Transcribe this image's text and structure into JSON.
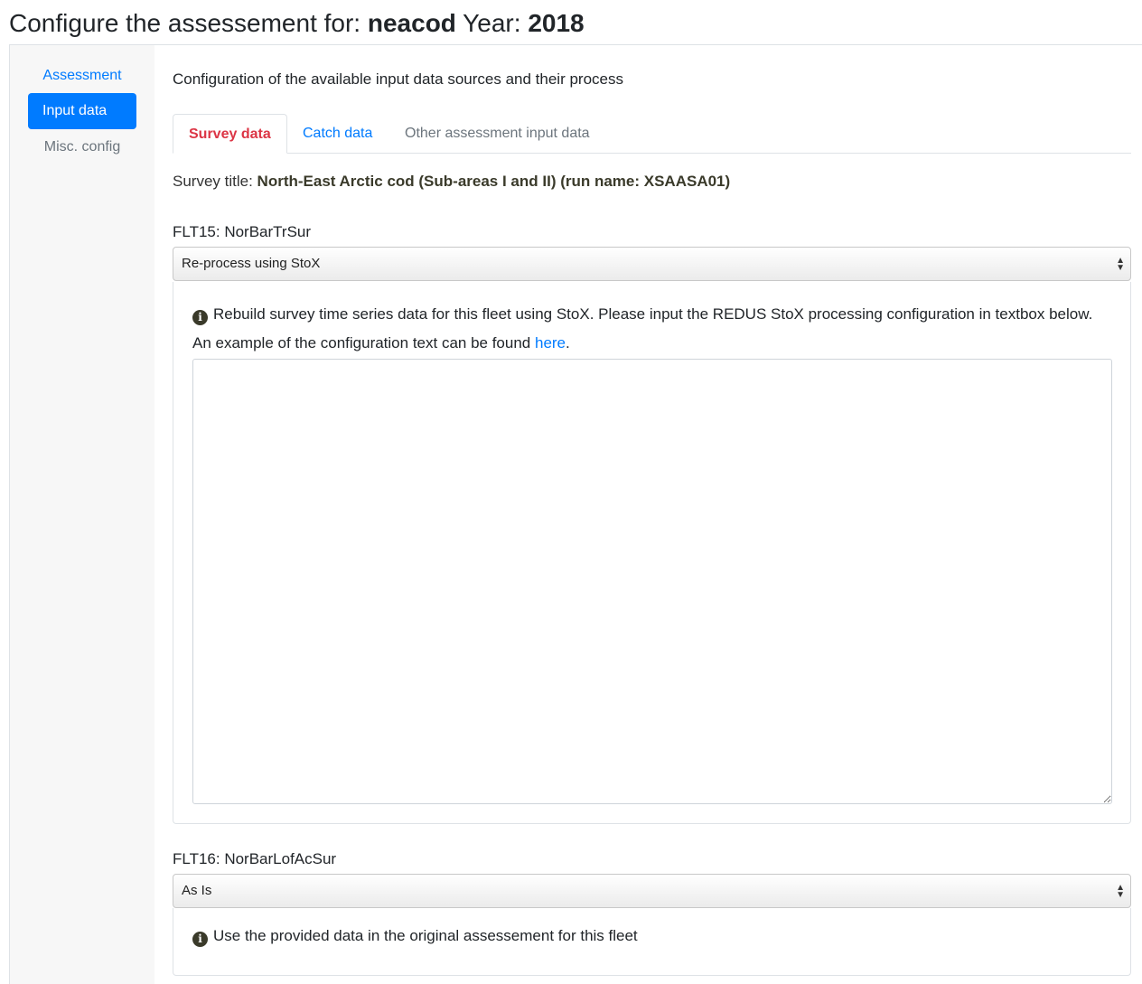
{
  "header": {
    "prefix": "Configure the assessement for: ",
    "stock": "neacod",
    "year_label": " Year: ",
    "year": "2018"
  },
  "sidebar": {
    "items": [
      {
        "label": "Assessment"
      },
      {
        "label": "Input data"
      },
      {
        "label": "Misc. config"
      }
    ]
  },
  "main": {
    "intro": "Configuration of the available input data sources and their process",
    "tabs": [
      {
        "label": "Survey data"
      },
      {
        "label": "Catch data"
      },
      {
        "label": "Other assessment input data"
      }
    ],
    "survey_title_label": "Survey title: ",
    "survey_title_value": "North-East Arctic cod (Sub-areas I and II) (run name: XSAASA01)"
  },
  "fleets": [
    {
      "label": "FLT15: NorBarTrSur",
      "selected": "Re-process using StoX",
      "info": "Rebuild survey time series data for this fleet using StoX. Please input the REDUS StoX processing configuration in textbox below. An example of the configuration text can be found ",
      "link": "here",
      "info_end": ".",
      "textarea_value": ""
    },
    {
      "label": "FLT16: NorBarLofAcSur",
      "selected": "As Is",
      "info": "Use the provided data in the original assessement for this fleet"
    }
  ],
  "icons": {
    "info": "info-circle-icon",
    "select_arrows": "updown-arrows-icon"
  },
  "colors": {
    "primary": "#007bff",
    "active_tab": "#dc3545",
    "sidebar_bg": "#f7f7f7"
  }
}
